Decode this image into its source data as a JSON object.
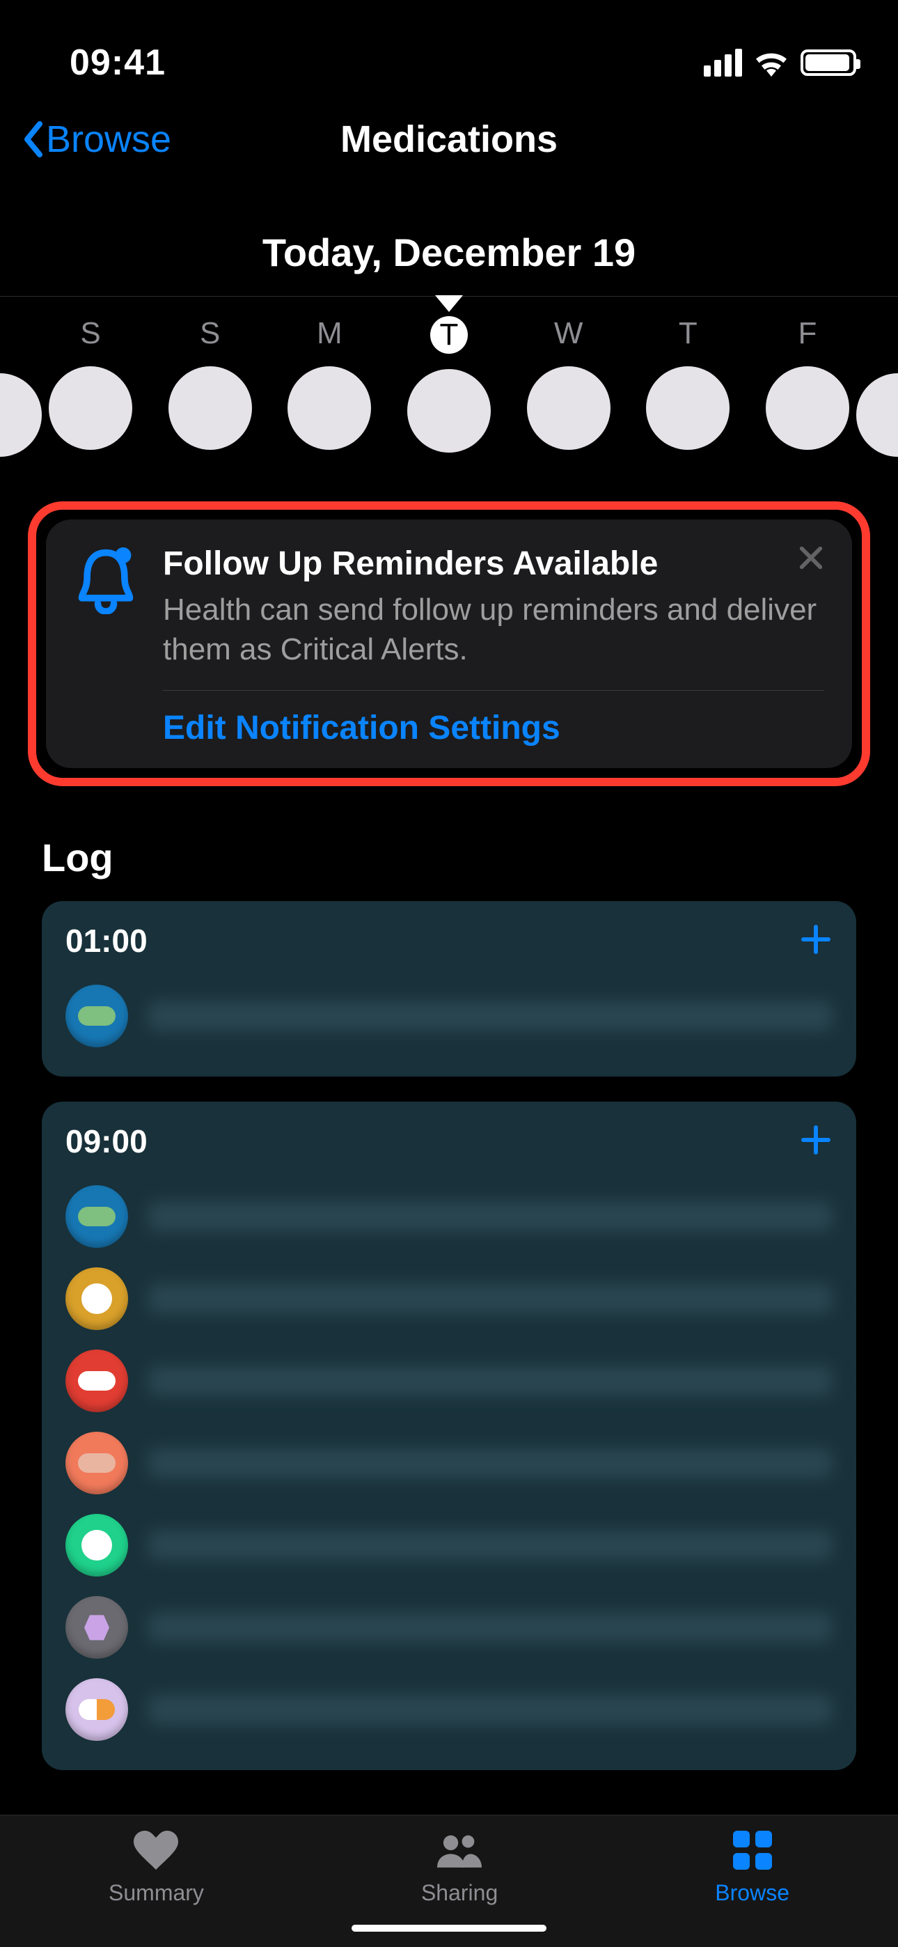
{
  "status": {
    "time": "09:41"
  },
  "nav": {
    "back_label": "Browse",
    "title": "Medications"
  },
  "date_header": "Today, December 19",
  "week": {
    "days": [
      {
        "label": "S",
        "active": false
      },
      {
        "label": "S",
        "active": false
      },
      {
        "label": "M",
        "active": false
      },
      {
        "label": "T",
        "active": true
      },
      {
        "label": "W",
        "active": false
      },
      {
        "label": "T",
        "active": false
      },
      {
        "label": "F",
        "active": false
      }
    ]
  },
  "notification": {
    "title": "Follow Up Reminders Available",
    "description": "Health can send follow up reminders and deliver them as Critical Alerts.",
    "action_label": "Edit Notification Settings"
  },
  "log": {
    "section_title": "Log",
    "groups": [
      {
        "time": "01:00",
        "meds": [
          {
            "icon_color": "#1777b3",
            "shape": "pill",
            "pill_color": "#7fbf7f"
          }
        ]
      },
      {
        "time": "09:00",
        "meds": [
          {
            "icon_color": "#1777b3",
            "shape": "pill",
            "pill_color": "#7fbf7f"
          },
          {
            "icon_color": "#d9a02a",
            "shape": "round",
            "pill_color": "#ffffff"
          },
          {
            "icon_color": "#e13d32",
            "shape": "pill",
            "pill_color": "#ffffff"
          },
          {
            "icon_color": "#f17a5b",
            "shape": "pill",
            "pill_color": "#e9b5a0"
          },
          {
            "icon_color": "#1fd18b",
            "shape": "round",
            "pill_color": "#ffffff"
          },
          {
            "icon_color": "#6a6a70",
            "shape": "hex",
            "pill_color": "#c9a3e6"
          },
          {
            "icon_color": "#d6c2ea",
            "shape": "halfpill",
            "pill_color": "#ffffff"
          }
        ]
      }
    ]
  },
  "tabs": {
    "items": [
      {
        "label": "Summary",
        "icon": "heart",
        "active": false
      },
      {
        "label": "Sharing",
        "icon": "people",
        "active": false
      },
      {
        "label": "Browse",
        "icon": "grid",
        "active": true
      }
    ]
  }
}
